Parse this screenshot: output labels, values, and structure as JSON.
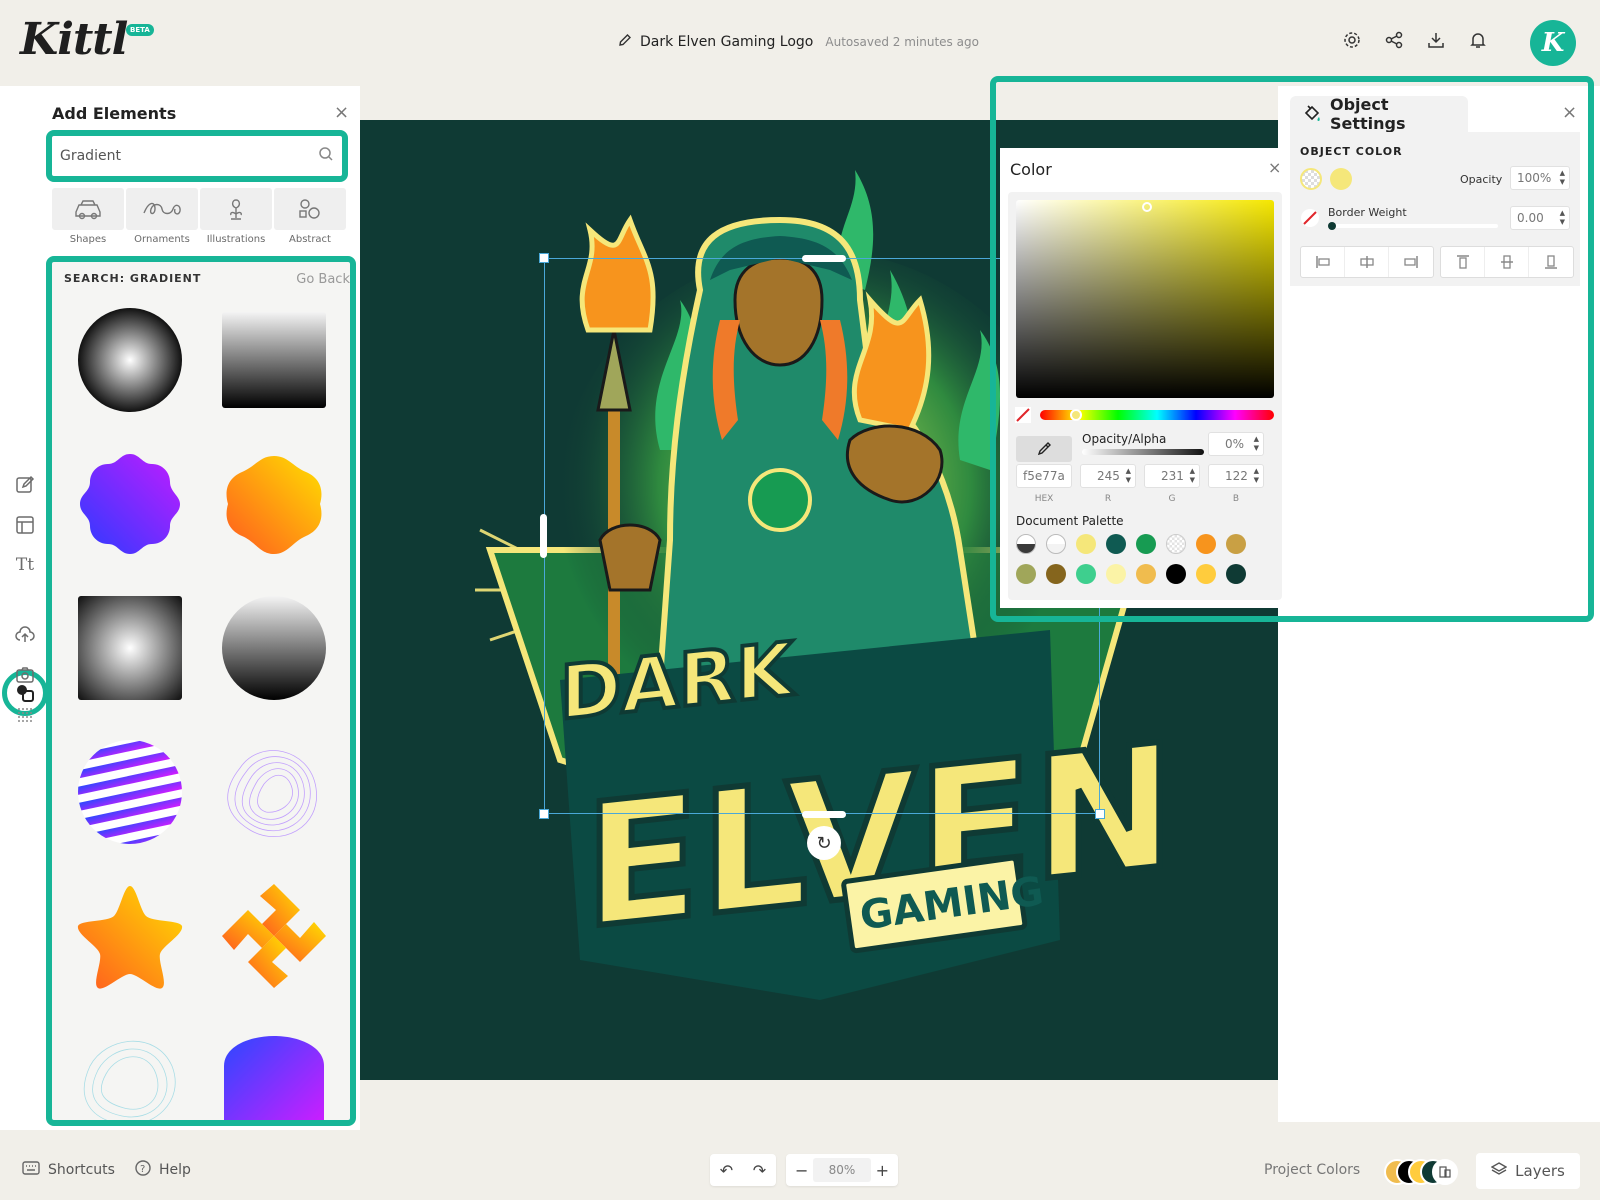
{
  "app": {
    "logo": "Kittl",
    "beta_badge": "BETA"
  },
  "header": {
    "doc_title": "Dark Elven Gaming Logo",
    "autosave": "Autosaved 2 minutes ago",
    "avatar_letter": "K",
    "icons": [
      "settings-icon",
      "share-icon",
      "download-icon",
      "bell-icon"
    ]
  },
  "rail": {
    "items": [
      "edit-icon",
      "layout-icon",
      "text-icon",
      "elements-icon",
      "upload-icon",
      "camera-icon",
      "grid-icon"
    ],
    "active": "elements-icon"
  },
  "add_elements": {
    "title": "Add Elements",
    "search_value": "Gradient",
    "categories": [
      {
        "label": "Shapes",
        "icon": "car-shape-icon"
      },
      {
        "label": "Ornaments",
        "icon": "ornament-icon"
      },
      {
        "label": "Illustrations",
        "icon": "flower-icon"
      },
      {
        "label": "Abstract",
        "icon": "circles-icon"
      }
    ],
    "results_heading": "SEARCH: GRADIENT",
    "go_back": "Go Back",
    "results": [
      "radial-gray-circle",
      "gray-black-square",
      "blue-purple-blob",
      "orange-yellow-blob",
      "radial-gray-square",
      "gray-black-circle",
      "purple-striped-sphere",
      "purple-wave-blob",
      "orange-star",
      "orange-diamond-knot",
      "teal-wave-blob",
      "blue-purple-shape"
    ]
  },
  "canvas": {
    "artwork_text": [
      "DARK",
      "ELVEN",
      "GAMING"
    ],
    "background": "#0f3a34"
  },
  "object_settings": {
    "title": "Object Settings",
    "object_color_label": "OBJECT COLOR",
    "opacity_label": "Opacity",
    "opacity_value": "100%",
    "border_weight_label": "Border Weight",
    "border_weight_value": "0.00",
    "align_icons": [
      "align-left-icon",
      "align-center-h-icon",
      "align-right-icon",
      "align-top-icon",
      "align-middle-v-icon",
      "align-bottom-icon"
    ]
  },
  "color_picker": {
    "title": "Color",
    "opacity_label": "Opacity/Alpha",
    "opacity_value": "0%",
    "hex": "f5e77a",
    "r": "245",
    "g": "231",
    "b": "122",
    "hex_label": "HEX",
    "r_label": "R",
    "g_label": "G",
    "b_label": "B",
    "palette_title": "Document Palette",
    "palette": [
      "#3a3a3a",
      "#f3f3f3",
      "#f5e77a",
      "#0f5a52",
      "#179b52",
      "#e9e2a8",
      "#f7941d",
      "#c9a044",
      "#a0a65a",
      "#85651d",
      "#3ecf8e",
      "#fbf3a6",
      "#f0bc4e",
      "#000000",
      "#ffcc3d",
      "#0f3a34"
    ]
  },
  "bottom": {
    "shortcuts": "Shortcuts",
    "help": "Help",
    "zoom": "80%",
    "project_colors": "Project Colors",
    "layers": "Layers"
  },
  "colors": {
    "accent": "#17b597",
    "canvas_bg": "#0f3a34",
    "selected_color": "#f5e77a"
  }
}
